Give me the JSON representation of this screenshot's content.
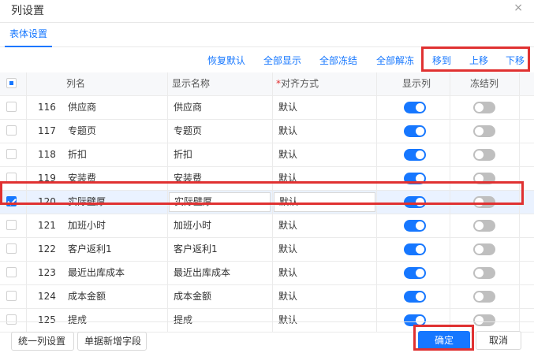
{
  "dialog": {
    "title": "列设置",
    "close_glyph": "×"
  },
  "tabs": [
    {
      "label": "表体设置"
    }
  ],
  "toolbar": {
    "restore_default": "恢复默认",
    "show_all": "全部显示",
    "freeze_all": "全部冻结",
    "unfreeze_all": "全部解冻",
    "move_to": "移到",
    "move_up": "上移",
    "move_down": "下移"
  },
  "table": {
    "headers": {
      "col_name": "列名",
      "display_name": "显示名称",
      "align_required": "*",
      "align": "对齐方式",
      "show_col": "显示列",
      "freeze_col": "冻结列"
    },
    "rows": [
      {
        "no": "116",
        "col_name": "供应商",
        "display_name": "供应商",
        "align": "默认",
        "show": true,
        "freeze": false,
        "selected": false
      },
      {
        "no": "117",
        "col_name": "专题页",
        "display_name": "专题页",
        "align": "默认",
        "show": true,
        "freeze": false,
        "selected": false
      },
      {
        "no": "118",
        "col_name": "折扣",
        "display_name": "折扣",
        "align": "默认",
        "show": true,
        "freeze": false,
        "selected": false
      },
      {
        "no": "119",
        "col_name": "安装费",
        "display_name": "安装费",
        "align": "默认",
        "show": true,
        "freeze": false,
        "selected": false
      },
      {
        "no": "120",
        "col_name": "实际壁厚",
        "display_name": "实际壁厚",
        "align": "默认",
        "show": true,
        "freeze": false,
        "selected": true
      },
      {
        "no": "121",
        "col_name": "加班小时",
        "display_name": "加班小时",
        "align": "默认",
        "show": true,
        "freeze": false,
        "selected": false
      },
      {
        "no": "122",
        "col_name": "客户返利1",
        "display_name": "客户返利1",
        "align": "默认",
        "show": true,
        "freeze": false,
        "selected": false
      },
      {
        "no": "123",
        "col_name": "最近出库成本",
        "display_name": "最近出库成本",
        "align": "默认",
        "show": true,
        "freeze": false,
        "selected": false
      },
      {
        "no": "124",
        "col_name": "成本金额",
        "display_name": "成本金额",
        "align": "默认",
        "show": true,
        "freeze": false,
        "selected": false
      },
      {
        "no": "125",
        "col_name": "提成",
        "display_name": "提成",
        "align": "默认",
        "show": true,
        "freeze": false,
        "selected": false
      }
    ]
  },
  "footer": {
    "unify_columns": "统一列设置",
    "add_field": "单据新增字段",
    "confirm": "确定",
    "cancel": "取消"
  },
  "colors": {
    "accent": "#1677ff",
    "highlight_box": "#e03131",
    "toggle_off": "#bfbfbf"
  }
}
